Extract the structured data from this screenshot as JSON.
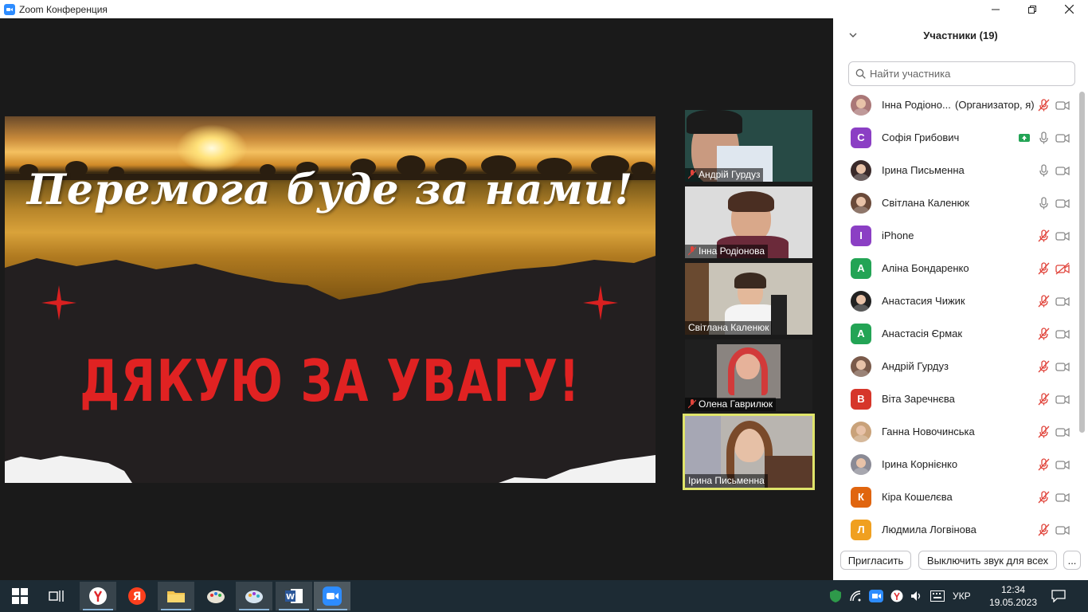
{
  "window": {
    "title": "Zoom Конференция"
  },
  "slide": {
    "headline": "Перемога буде за нами!",
    "thanks": "ДЯКУЮ ЗА УВАГУ!"
  },
  "thumbnails": [
    {
      "name": "Андрій Гурдуз",
      "muted": true,
      "active": false
    },
    {
      "name": "Інна Родіонова",
      "muted": true,
      "active": false
    },
    {
      "name": "Світлана Каленюк",
      "muted": false,
      "active": false
    },
    {
      "name": "Олена Гаврилюк",
      "muted": true,
      "active": false
    },
    {
      "name": "Ірина Письменна",
      "muted": false,
      "active": true
    }
  ],
  "participants_panel": {
    "title": "Участники (19)",
    "search_placeholder": "Найти участника",
    "invite_label": "Пригласить",
    "mute_all_label": "Выключить звук для всех",
    "more_label": "...",
    "participants": [
      {
        "name": "Інна Родіоно...",
        "role": "(Организатор, я)",
        "avatar_letter": "",
        "avatar_color": "#a77",
        "mic": "muted",
        "video": "on",
        "photo": true
      },
      {
        "name": "Софія Грибович",
        "role": "",
        "avatar_letter": "С",
        "avatar_color": "#8b3fc4",
        "mic": "on",
        "video": "on",
        "photo": false,
        "screen_share": true
      },
      {
        "name": "Ірина Письменна",
        "role": "",
        "avatar_letter": "",
        "avatar_color": "#3a2a2a",
        "mic": "on",
        "video": "on",
        "photo": true
      },
      {
        "name": "Світлана Каленюк",
        "role": "",
        "avatar_letter": "",
        "avatar_color": "#6a4a3a",
        "mic": "on",
        "video": "on",
        "photo": true
      },
      {
        "name": "iPhone",
        "role": "",
        "avatar_letter": "I",
        "avatar_color": "#8b3fc4",
        "mic": "muted",
        "video": "on",
        "photo": false
      },
      {
        "name": "Аліна Бондаренко",
        "role": "",
        "avatar_letter": "А",
        "avatar_color": "#23a455",
        "mic": "muted",
        "video": "off",
        "photo": false
      },
      {
        "name": "Анастасия Чижик",
        "role": "",
        "avatar_letter": "",
        "avatar_color": "#222",
        "mic": "muted",
        "video": "on",
        "photo": true
      },
      {
        "name": "Анастасія Єрмак",
        "role": "",
        "avatar_letter": "А",
        "avatar_color": "#23a455",
        "mic": "muted",
        "video": "on",
        "photo": false
      },
      {
        "name": "Андрій Гурдуз",
        "role": "",
        "avatar_letter": "",
        "avatar_color": "#7a5a4a",
        "mic": "muted",
        "video": "on",
        "photo": true
      },
      {
        "name": "Віта Заречнєва",
        "role": "",
        "avatar_letter": "В",
        "avatar_color": "#d6362a",
        "mic": "muted",
        "video": "on",
        "photo": false
      },
      {
        "name": "Ганна Новочинська",
        "role": "",
        "avatar_letter": "",
        "avatar_color": "#c9a27a",
        "mic": "muted",
        "video": "on",
        "photo": true
      },
      {
        "name": "Ірина Корнієнко",
        "role": "",
        "avatar_letter": "",
        "avatar_color": "#8a8a95",
        "mic": "muted",
        "video": "on",
        "photo": true
      },
      {
        "name": "Кіра Кошелєва",
        "role": "",
        "avatar_letter": "К",
        "avatar_color": "#e0650f",
        "mic": "muted",
        "video": "on",
        "photo": false
      },
      {
        "name": "Людмила Логвінова",
        "role": "",
        "avatar_letter": "Л",
        "avatar_color": "#f0a020",
        "mic": "muted",
        "video": "on",
        "photo": false
      }
    ]
  },
  "taskbar": {
    "language": "УКР",
    "time": "12:34",
    "date": "19.05.2023"
  },
  "colors": {
    "accent": "#2d8cff",
    "muted_red": "#e0443b",
    "slide_red": "#e02222",
    "active_outline": "#dfe46a"
  }
}
